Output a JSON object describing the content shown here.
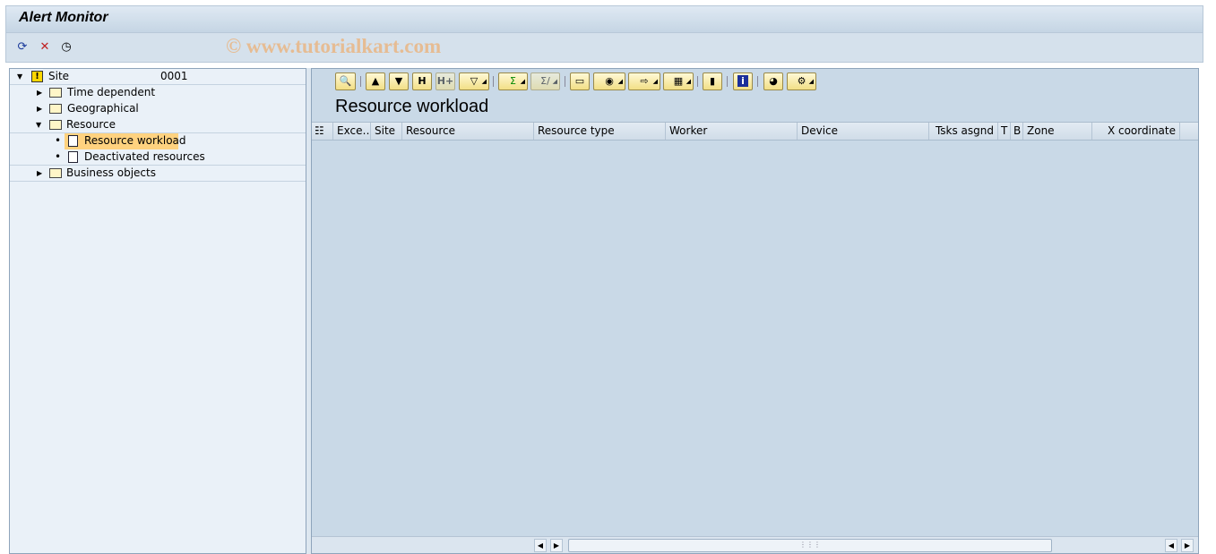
{
  "window": {
    "title": "Alert Monitor"
  },
  "app_toolbar": {
    "icons": [
      "refresh-icon",
      "delete-alert-icon",
      "clock-icon"
    ]
  },
  "watermark": "© www.tutorialkart.com",
  "tree": {
    "root": {
      "label": "Site",
      "value": "0001",
      "icon": "warning-icon"
    },
    "items": [
      {
        "label": "Time dependent",
        "expanded": false
      },
      {
        "label": "Geographical",
        "expanded": false
      },
      {
        "label": "Resource",
        "expanded": true,
        "children": [
          {
            "label": "Resource workload",
            "selected": true
          },
          {
            "label": "Deactivated resources"
          }
        ]
      },
      {
        "label": "Business objects",
        "expanded": false
      }
    ]
  },
  "grid": {
    "title": "Resource workload",
    "toolbar": [
      "details",
      "sort-ascending",
      "sort-descending",
      "find",
      "find-next",
      "filter",
      "sum",
      "subtotals",
      "print-preview",
      "views",
      "export",
      "layout",
      "graphic",
      "end-user-information",
      "color",
      "settings"
    ],
    "columns": [
      "Exce…",
      "Site",
      "Resource",
      "Resource type",
      "Worker",
      "Device",
      "Tsks asgnd",
      "T",
      "B",
      "Zone",
      "X coordinate"
    ],
    "rows": []
  },
  "colors": {
    "selected": "#ffd27f",
    "background": "#c9d9e7",
    "button": "#f5e49a"
  }
}
